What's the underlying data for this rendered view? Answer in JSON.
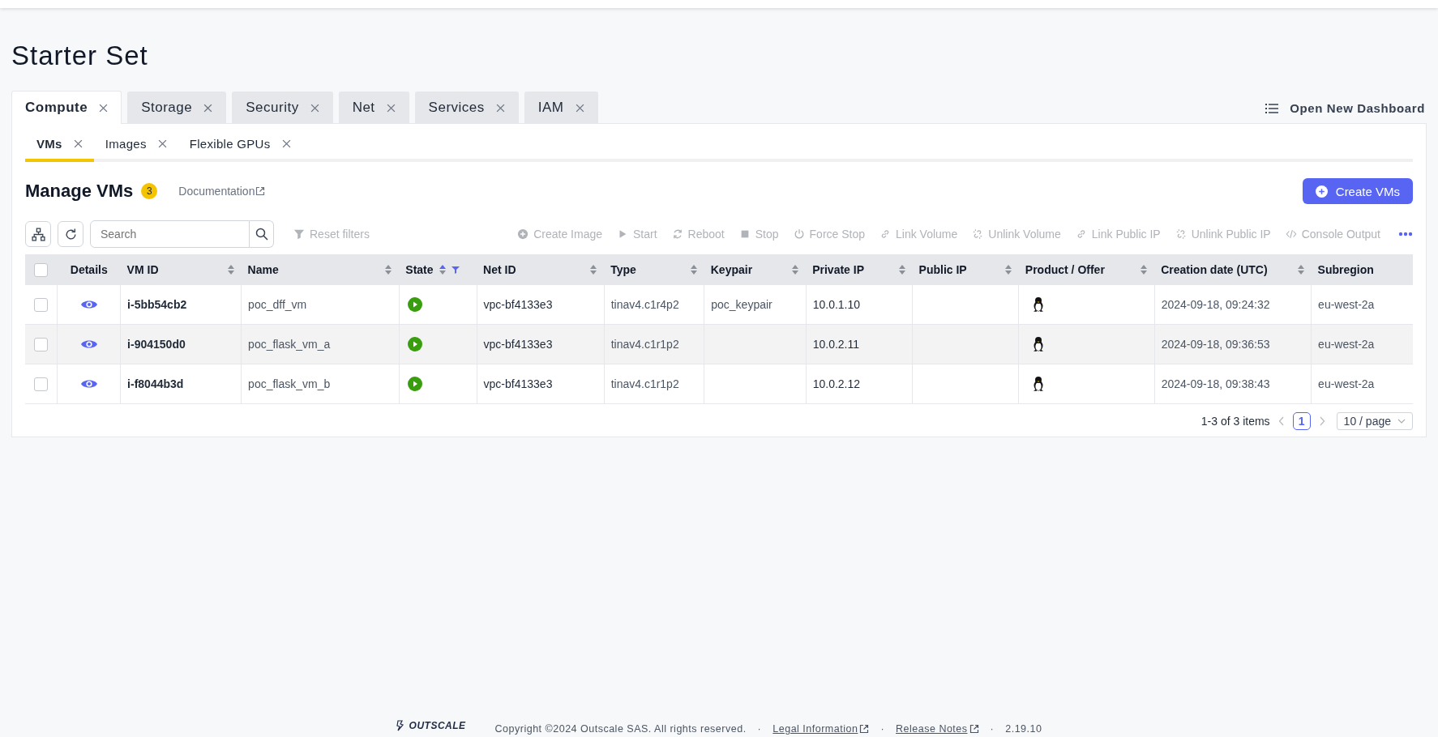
{
  "page_title": "Starter Set",
  "tabs": [
    {
      "label": "Compute",
      "selected": true
    },
    {
      "label": "Storage",
      "selected": false
    },
    {
      "label": "Security",
      "selected": false
    },
    {
      "label": "Net",
      "selected": false
    },
    {
      "label": "Services",
      "selected": false
    },
    {
      "label": "IAM",
      "selected": false
    }
  ],
  "open_dashboard": "Open New Dashboard",
  "subtabs": [
    {
      "label": "VMs",
      "selected": true
    },
    {
      "label": "Images",
      "selected": false
    },
    {
      "label": "Flexible GPUs",
      "selected": false
    }
  ],
  "header": {
    "title": "Manage VMs",
    "count": "3",
    "doc_link": "Documentation",
    "create_button": "Create VMs"
  },
  "toolbar": {
    "search_placeholder": "Search",
    "reset_filters": {
      "label": "Reset filters",
      "disabled": true
    },
    "actions": [
      {
        "kind": "create",
        "label": "Create Image",
        "disabled": true
      },
      {
        "kind": "start",
        "label": "Start",
        "disabled": true
      },
      {
        "kind": "reboot",
        "label": "Reboot",
        "disabled": true
      },
      {
        "kind": "stop",
        "label": "Stop",
        "disabled": true
      },
      {
        "kind": "power",
        "label": "Force Stop",
        "disabled": true
      },
      {
        "kind": "link",
        "label": "Link Volume",
        "disabled": true
      },
      {
        "kind": "unlink",
        "label": "Unlink Volume",
        "disabled": true
      },
      {
        "kind": "link",
        "label": "Link Public IP",
        "disabled": true
      },
      {
        "kind": "unlink",
        "label": "Unlink Public IP",
        "disabled": true
      },
      {
        "kind": "code",
        "label": "Console Output",
        "disabled": true
      }
    ]
  },
  "table": {
    "select_all_checked": false,
    "columns": [
      {
        "label": "Details",
        "sortable": false,
        "sorted_ascending": false,
        "filtered": false
      },
      {
        "label": "VM ID",
        "sortable": true,
        "sorted_ascending": false,
        "filtered": false
      },
      {
        "label": "Name",
        "sortable": true,
        "sorted_ascending": false,
        "filtered": false
      },
      {
        "label": "State",
        "sortable": true,
        "sorted_ascending": true,
        "filtered": true
      },
      {
        "label": "Net ID",
        "sortable": true,
        "sorted_ascending": false,
        "filtered": false
      },
      {
        "label": "Type",
        "sortable": true,
        "sorted_ascending": false,
        "filtered": false
      },
      {
        "label": "Keypair",
        "sortable": true,
        "sorted_ascending": false,
        "filtered": false
      },
      {
        "label": "Private IP",
        "sortable": true,
        "sorted_ascending": false,
        "filtered": false
      },
      {
        "label": "Public IP",
        "sortable": true,
        "sorted_ascending": false,
        "filtered": false
      },
      {
        "label": "Product / Offer",
        "sortable": true,
        "sorted_ascending": false,
        "filtered": false
      },
      {
        "label": "Creation date (UTC)",
        "sortable": true,
        "sorted_ascending": false,
        "filtered": false
      },
      {
        "label": "Subregion",
        "sortable": false,
        "sorted_ascending": false,
        "filtered": false
      }
    ],
    "rows": [
      {
        "checked": false,
        "selected": false,
        "vm_id": "i-5bb54cb2",
        "name": "poc_dff_vm",
        "running": true,
        "net_id": "vpc-bf4133e3",
        "type": "tinav4.c1r4p2",
        "keypair": "poc_keypair",
        "private_ip": "10.0.1.10",
        "creation_date": "2024-09-18, 09:24:32",
        "subregion": "eu-west-2a"
      },
      {
        "checked": false,
        "selected": true,
        "vm_id": "i-904150d0",
        "name": "poc_flask_vm_a",
        "running": true,
        "net_id": "vpc-bf4133e3",
        "type": "tinav4.c1r1p2",
        "private_ip": "10.0.2.11",
        "creation_date": "2024-09-18, 09:36:53",
        "subregion": "eu-west-2a"
      },
      {
        "checked": false,
        "selected": false,
        "vm_id": "i-f8044b3d",
        "name": "poc_flask_vm_b",
        "running": true,
        "net_id": "vpc-bf4133e3",
        "type": "tinav4.c1r1p2",
        "private_ip": "10.0.2.12",
        "creation_date": "2024-09-18, 09:38:43",
        "subregion": "eu-west-2a"
      }
    ]
  },
  "pagination": {
    "summary": "1-3 of 3 items",
    "pages": [
      {
        "label": "1",
        "selected": true
      }
    ],
    "page_size": "10 / page"
  },
  "footer": {
    "logo": "OUTSCALE",
    "copyright": "Copyright ©2024 Outscale SAS. All rights reserved.",
    "separator": "·",
    "links": [
      "Legal Information",
      "Release Notes"
    ],
    "version": "2.19.10"
  }
}
